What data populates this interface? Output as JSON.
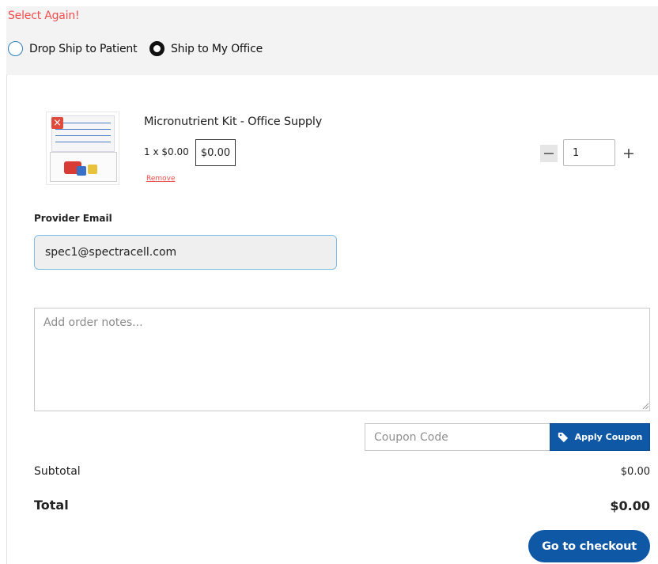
{
  "shipping": {
    "alert": "Select Again!",
    "options": [
      {
        "label": "Drop Ship to Patient",
        "selected": false
      },
      {
        "label": "Ship to My Office",
        "selected": true
      }
    ]
  },
  "cart_item": {
    "name": "Micronutrient Kit - Office Supply",
    "price_line": "1 x $0.00",
    "line_total": "$0.00",
    "remove_label": "Remove",
    "remove_icon": "close-icon",
    "quantity": "1",
    "minus_symbol": "−",
    "plus_symbol": "+"
  },
  "provider": {
    "label": "Provider Email",
    "value": "spec1@spectracell.com"
  },
  "notes": {
    "placeholder": "Add order notes..."
  },
  "coupon": {
    "placeholder": "Coupon Code",
    "button_label": "Apply Coupon",
    "button_icon": "tag-icon"
  },
  "totals": {
    "subtotal_label": "Subtotal",
    "subtotal_value": "$0.00",
    "total_label": "Total",
    "total_value": "$0.00"
  },
  "checkout": {
    "button_label": "Go to checkout"
  },
  "colors": {
    "alert": "#f24d4d",
    "brand_blue": "#0f58a6",
    "radio_ring": "#2d7fc1",
    "input_focus": "#7fbfe8",
    "panel_bg": "#f3f3f3"
  }
}
